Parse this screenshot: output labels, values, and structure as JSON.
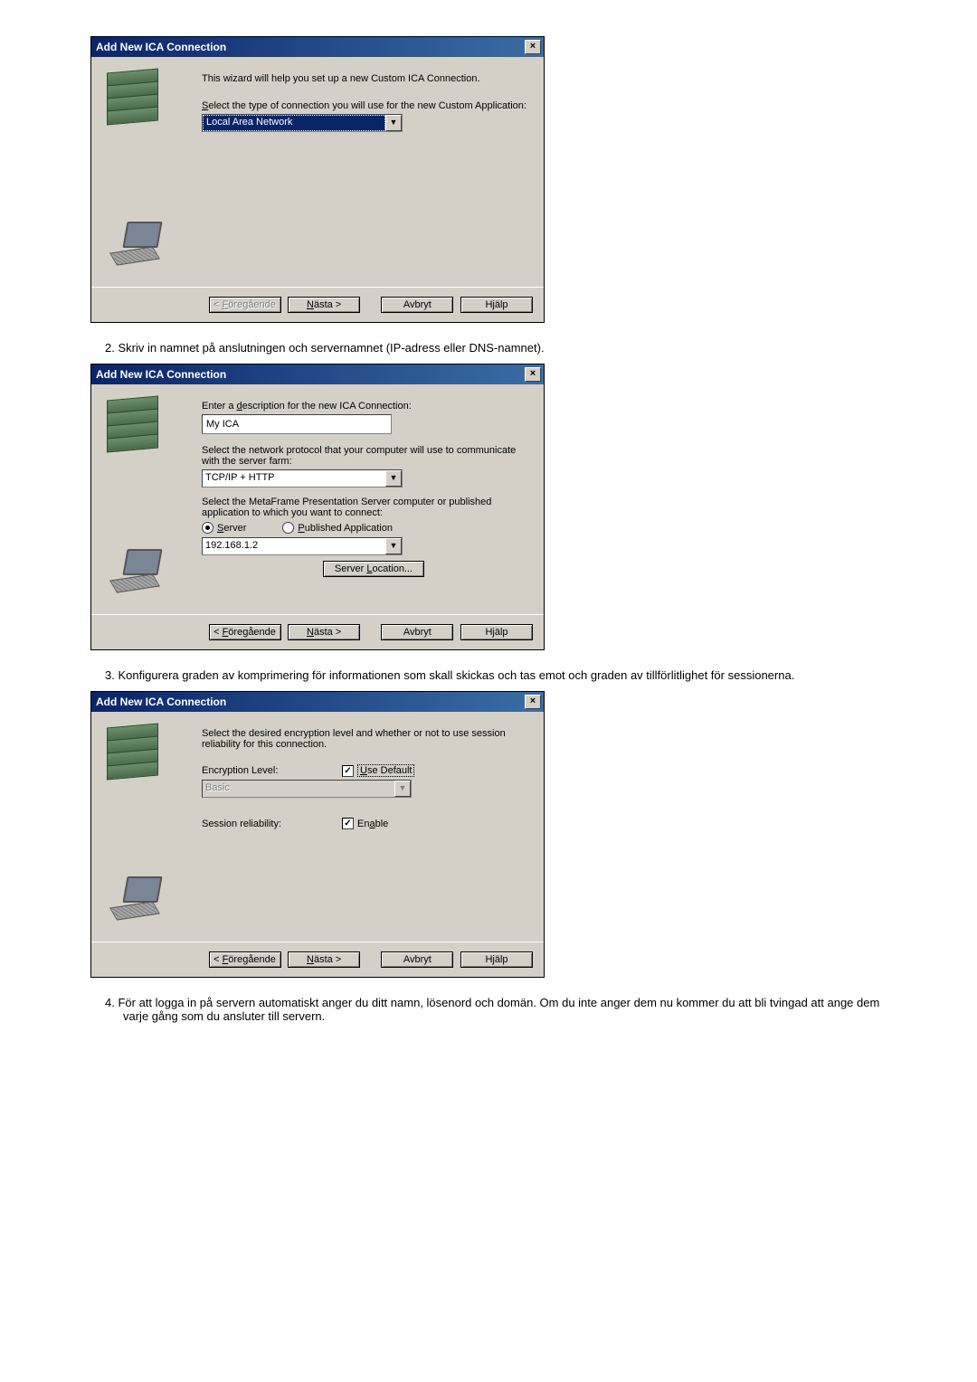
{
  "dlg1": {
    "title": "Add New ICA Connection",
    "intro": "This wizard will help you set up a new Custom ICA Connection.",
    "select_prefix": "S",
    "select_rest": "elect the type of connection you will use for the new Custom Application:",
    "conn_type": "Local Area Network",
    "btn_prev_prefix": "< ",
    "btn_prev_u": "F",
    "btn_prev_rest": "öregående",
    "btn_next_u": "N",
    "btn_next_rest": "ästa >",
    "btn_cancel": "Avbryt",
    "btn_help": "Hjälp"
  },
  "step2": "2.   Skriv in namnet på anslutningen och servernamnet (IP-adress eller DNS-namnet).",
  "dlg2": {
    "title": "Add New ICA Connection",
    "desc_prefix": "Enter a ",
    "desc_u": "d",
    "desc_rest": "escription for the new ICA Connection:",
    "desc_val": "My ICA",
    "proto_text": "Select the network protocol that your computer will use to communicate with the server farm:",
    "proto_val": "TCP/IP + HTTP",
    "meta_text": "Select the MetaFrame Presentation Server computer or published application to which you want to connect:",
    "radio1_u": "S",
    "radio1_rest": "erver",
    "radio2_u": "P",
    "radio2_rest": "ublished Application",
    "server_val": "192.168.1.2",
    "srv_loc_prefix": "Server ",
    "srv_loc_u": "L",
    "srv_loc_rest": "ocation...",
    "btn_prev_prefix": "< ",
    "btn_prev_u": "F",
    "btn_prev_rest": "öregående",
    "btn_next_u": "N",
    "btn_next_rest": "ästa >",
    "btn_cancel": "Avbryt",
    "btn_help": "Hjälp"
  },
  "step3": "3.   Konfigurera graden av komprimering för informationen som skall skickas och tas emot och graden av tillförlitlighet för sessionerna.",
  "dlg3": {
    "title": "Add New ICA Connection",
    "intro": "Select the desired encryption level and whether or not to use session reliability for this connection.",
    "enc_label": "Encryption Level:",
    "use_def_u": "U",
    "use_def_rest": "se Default",
    "enc_val": "Basic",
    "sess_label": "Session reliability:",
    "enable_prefix": "En",
    "enable_u": "a",
    "enable_rest": "ble",
    "btn_prev_prefix": "< ",
    "btn_prev_u": "F",
    "btn_prev_rest": "öregående",
    "btn_next_u": "N",
    "btn_next_rest": "ästa >",
    "btn_cancel": "Avbryt",
    "btn_help": "Hjälp"
  },
  "step4": "4.   För att logga in på servern automatiskt anger du ditt namn, lösenord och domän. Om du inte anger dem nu kommer du att bli tvingad att ange dem varje gång som du ansluter till servern."
}
